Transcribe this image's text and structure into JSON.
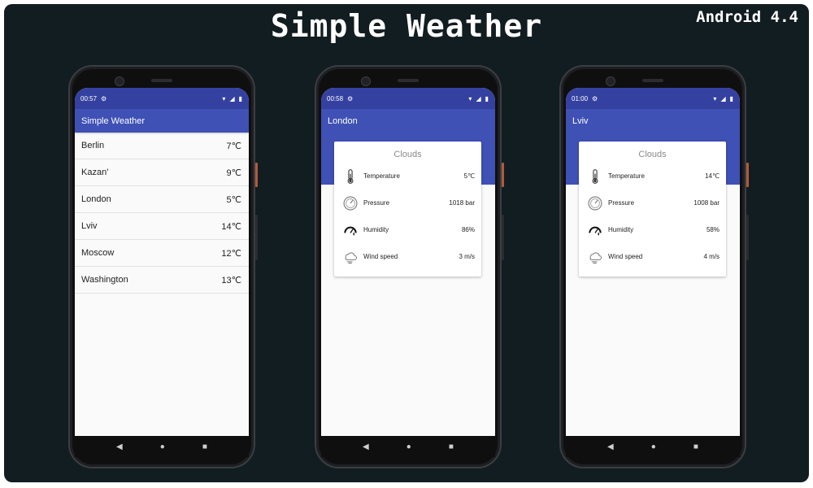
{
  "header": {
    "title": "Simple Weather",
    "platform": "Android 4.4"
  },
  "phones": [
    {
      "time": "00:57",
      "toolbar_title": "Simple Weather",
      "cities": [
        {
          "name": "Berlin",
          "temp": "7℃"
        },
        {
          "name": "Kazan'",
          "temp": "9℃"
        },
        {
          "name": "London",
          "temp": "5℃"
        },
        {
          "name": "Lviv",
          "temp": "14℃"
        },
        {
          "name": "Moscow",
          "temp": "12℃"
        },
        {
          "name": "Washington",
          "temp": "13℃"
        }
      ]
    },
    {
      "time": "00:58",
      "toolbar_title": "London",
      "card": {
        "condition": "Clouds",
        "metrics": [
          {
            "label": "Temperature",
            "value": "5℃",
            "icon": "thermometer-icon"
          },
          {
            "label": "Pressure",
            "value": "1018 bar",
            "icon": "pressure-gauge-icon"
          },
          {
            "label": "Humidity",
            "value": "86%",
            "icon": "humidity-icon"
          },
          {
            "label": "Wind speed",
            "value": "3 m/s",
            "icon": "wind-icon"
          }
        ]
      }
    },
    {
      "time": "01:00",
      "toolbar_title": "Lviv",
      "card": {
        "condition": "Clouds",
        "metrics": [
          {
            "label": "Temperature",
            "value": "14℃",
            "icon": "thermometer-icon"
          },
          {
            "label": "Pressure",
            "value": "1008 bar",
            "icon": "pressure-gauge-icon"
          },
          {
            "label": "Humidity",
            "value": "58%",
            "icon": "humidity-icon"
          },
          {
            "label": "Wind speed",
            "value": "4 m/s",
            "icon": "wind-icon"
          }
        ]
      }
    }
  ],
  "nav": {
    "back": "◀",
    "home": "●",
    "recents": "■"
  },
  "colors": {
    "background": "#121d21",
    "status_bar": "#3541a0",
    "toolbar": "#3f51b5"
  }
}
